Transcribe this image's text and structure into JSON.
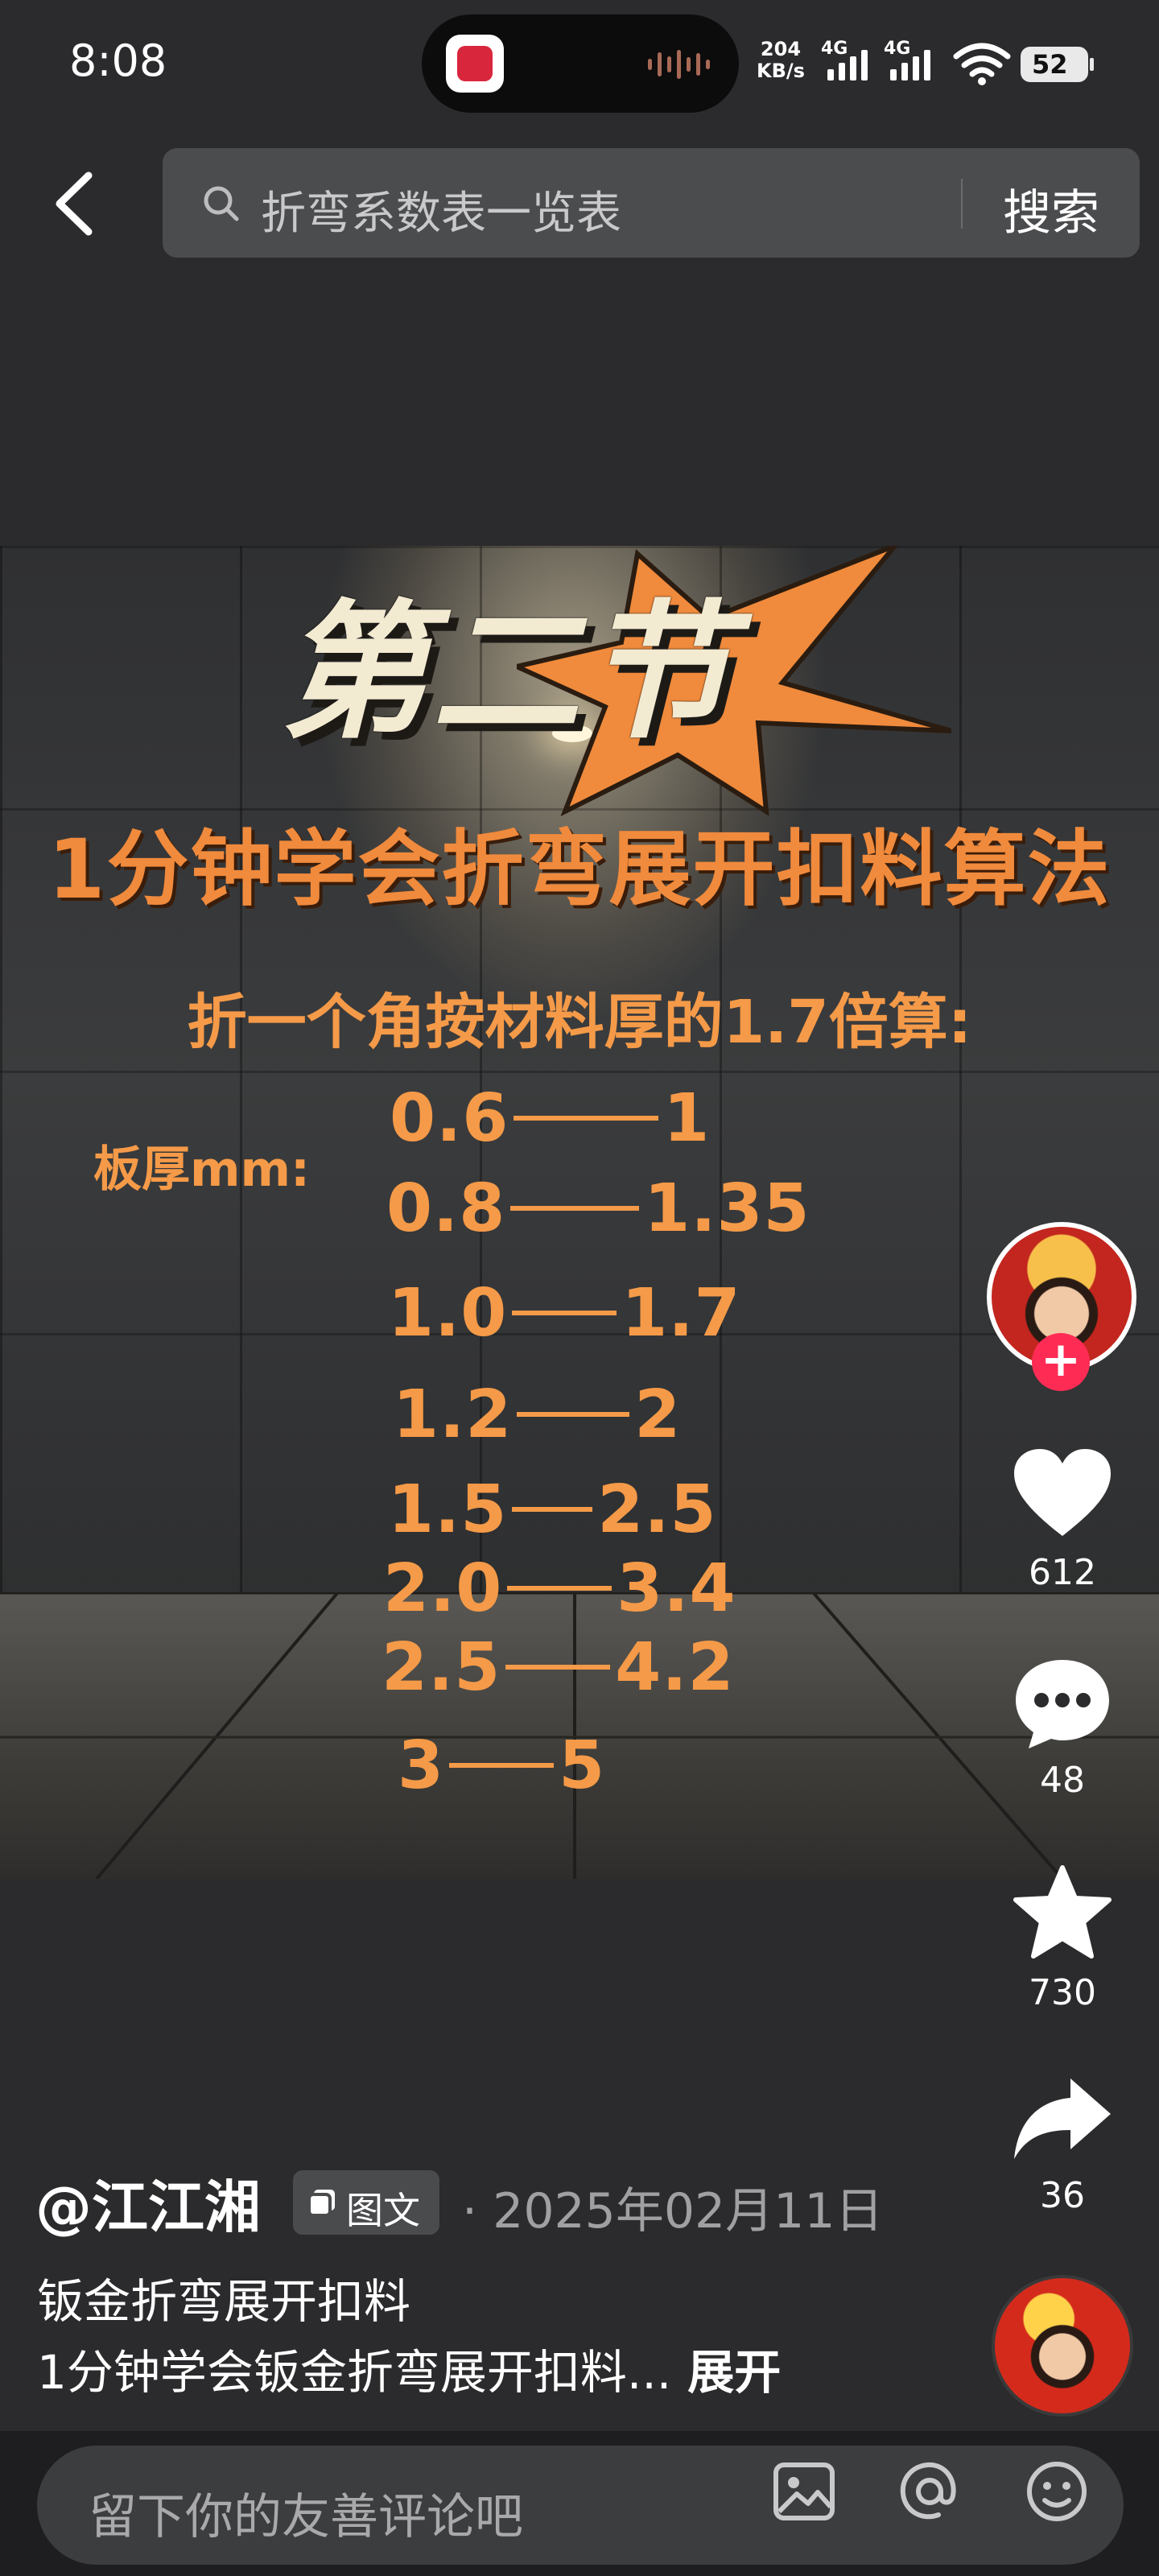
{
  "status_bar": {
    "time": "8:08",
    "net_speed_value": "204",
    "net_speed_unit": "KB/s",
    "sim1": "4G",
    "sim2": "4G",
    "battery": "52",
    "island_app_icon": "app-logo-icon",
    "island_activity_icon": "audio-wave-icon"
  },
  "header": {
    "back_icon": "chevron-left-icon",
    "search_icon": "search-icon",
    "search_query": "折弯系数表一览表",
    "search_button": "搜索"
  },
  "post_image": {
    "headline": "第二节",
    "subtitle": "1分钟学会折弯展开扣料算法",
    "rule": "折一个角按材料厚的1.7倍算:",
    "thickness_label": "板厚mm:",
    "table": [
      {
        "thickness": "0.6",
        "deduction": "1"
      },
      {
        "thickness": "0.8",
        "deduction": "1.35"
      },
      {
        "thickness": "1.0",
        "deduction": "1.7"
      },
      {
        "thickness": "1.2",
        "deduction": "2"
      },
      {
        "thickness": "1.5",
        "deduction": "2.5"
      },
      {
        "thickness": "2.0",
        "deduction": "3.4"
      },
      {
        "thickness": "2.5",
        "deduction": "4.2"
      },
      {
        "thickness": "3",
        "deduction": "5"
      }
    ],
    "colors": {
      "accent": "#f59a48",
      "burst": "#f08a3c",
      "headline": "#f3ead2"
    }
  },
  "actions": {
    "follow_icon": "plus-icon",
    "like_icon": "heart-icon",
    "like_count": "612",
    "comment_icon": "comment-bubble-icon",
    "comment_count": "48",
    "favorite_icon": "star-icon",
    "favorite_count": "730",
    "share_icon": "share-arrow-icon",
    "share_count": "36"
  },
  "post": {
    "author": "@江江湘",
    "type_badge": "图文",
    "date": "· 2025年02月11日",
    "title": "钣金折弯展开扣料",
    "body": "1分钟学会钣金折弯展开扣料...",
    "more": "展开"
  },
  "comment_bar": {
    "placeholder": "留下你的友善评论吧",
    "image_icon": "image-icon",
    "mention_icon": "at-mention-icon",
    "emoji_icon": "emoji-icon"
  }
}
